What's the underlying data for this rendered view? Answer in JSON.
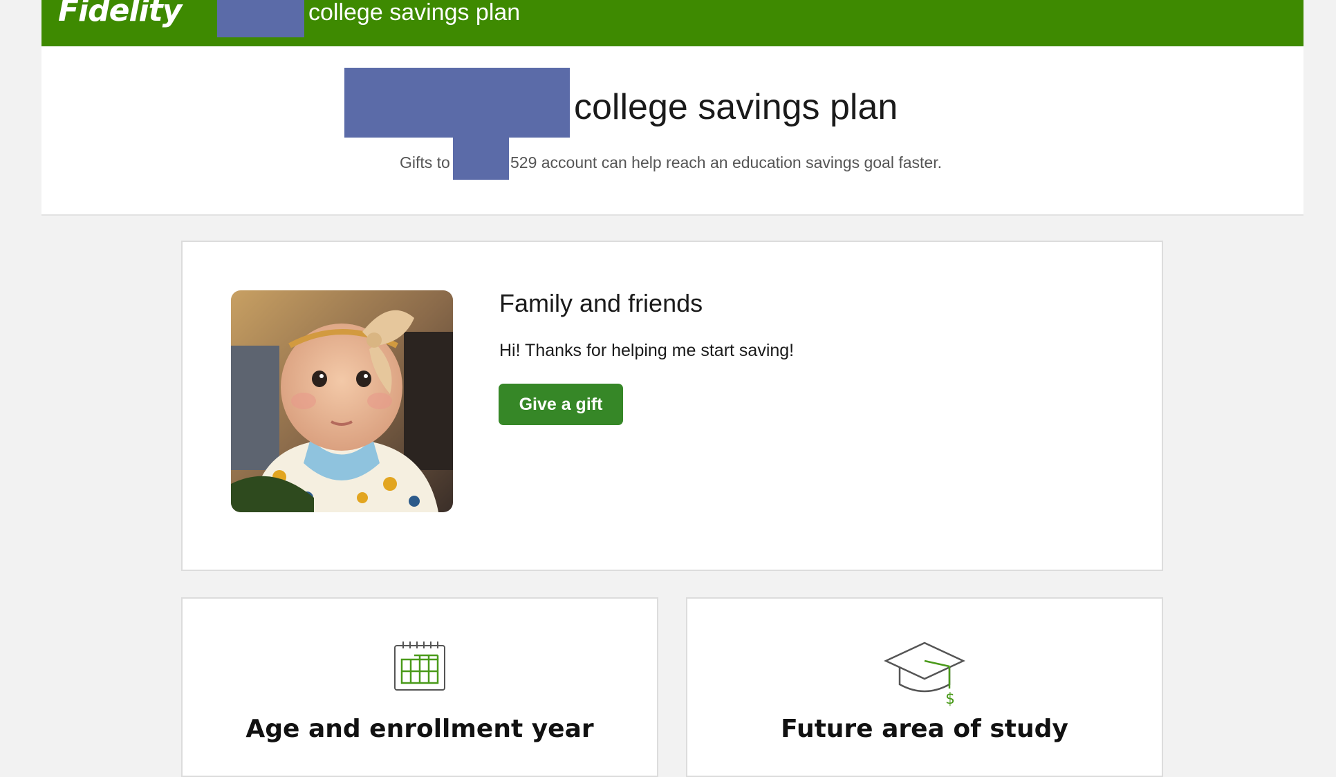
{
  "header": {
    "logo_text": "Fidelity",
    "title": "college savings plan"
  },
  "hero": {
    "title": "college savings plan",
    "subtitle_prefix": "Gifts to",
    "subtitle_suffix": "529 account can help reach an education savings goal faster."
  },
  "main_card": {
    "heading": "Family and friends",
    "message": "Hi! Thanks for helping me start saving!",
    "button_label": "Give a gift"
  },
  "info_cards": [
    {
      "title": "Age and enrollment year",
      "icon": "calendar-icon"
    },
    {
      "title": "Future area of study",
      "icon": "graduation-cap-icon"
    }
  ],
  "colors": {
    "brand_green": "#3e8a01",
    "button_green": "#368727",
    "redaction": "#5b6ba8"
  }
}
